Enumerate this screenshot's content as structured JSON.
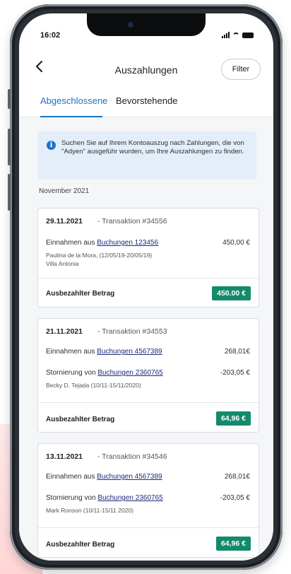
{
  "status_bar": {
    "time": "16:02"
  },
  "nav": {
    "back_icon": "chevron-left-icon",
    "title": "Auszahlungen",
    "filter_label": "Filter"
  },
  "tabs": [
    {
      "label": "Abgeschlossene",
      "active": true
    },
    {
      "label": "Bevorstehende",
      "active": false
    }
  ],
  "info": {
    "icon": "info-icon",
    "icon_glyph": "i",
    "text": "Suchen Sie auf Ihrem Kontoauszug nach Zahlungen, die von \"Adyen\" ausgeführ wurden, um Ihre Auszahlungen zu finden."
  },
  "month": "November 2021",
  "cards": [
    {
      "date": "29.11.2021",
      "transaction": "- Transaktion #34556",
      "lines": [
        {
          "prefix": "Einnahmen aus ",
          "link": "Buchungen 123456",
          "amount": "450,00 €",
          "details": [
            "Paulina de la Mora, (12/05/19-20/05/19)",
            "Villa Antonia"
          ]
        }
      ],
      "payout_label": "Ausbezahlter Betrag",
      "payout_amount": "450.00 €"
    },
    {
      "date": "21.11.2021",
      "transaction": "- Transaktion #34553",
      "lines": [
        {
          "prefix": "Einnahmen aus ",
          "link": "Buchungen 4567389",
          "amount": "268,01€",
          "details": []
        },
        {
          "prefix": "Stornierung von ",
          "link": "Buchungen 2360765",
          "amount": "-203,05 €",
          "details": [
            "Becky D. Tejada (10/11-15/11/2020)"
          ]
        }
      ],
      "payout_label": "Ausbezahlter Betrag",
      "payout_amount": "64,96 €"
    },
    {
      "date": "13.11.2021",
      "transaction": "- Transaktion #34546",
      "lines": [
        {
          "prefix": "Einnahmen aus ",
          "link": "Buchungen 4567389",
          "amount": "268,01€",
          "details": []
        },
        {
          "prefix": "Stornierung von ",
          "link": "Buchungen 2360765",
          "amount": "-203,05 €",
          "details": [
            "Mark Ronson (10/11-15/11 2020)"
          ]
        }
      ],
      "payout_label": "Ausbezahlter Betrag",
      "payout_amount": "64,96 €"
    }
  ],
  "colors": {
    "accent": "#1a73c8",
    "payout_badge": "#138a6b",
    "info_bg": "#e4eef8"
  }
}
